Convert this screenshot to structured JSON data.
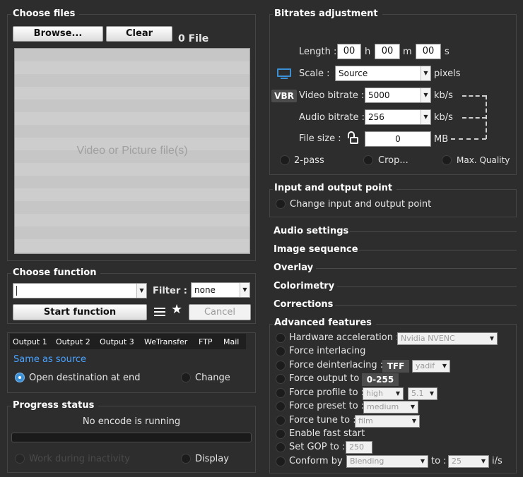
{
  "choose_files": {
    "title": "Choose files",
    "browse": "Browse...",
    "clear": "Clear",
    "file_count": "0 File",
    "drop_hint": "Video or Picture file(s)"
  },
  "choose_function": {
    "title": "Choose function",
    "function_value": "",
    "filter_label": "Filter :",
    "filter_value": "none",
    "start": "Start function",
    "cancel": "Cancel"
  },
  "output": {
    "tabs": [
      "Output 1",
      "Output 2",
      "Output 3",
      "WeTransfer",
      "FTP",
      "Mail"
    ],
    "destination": "Same as source",
    "open_dest": "Open destination at end",
    "change": "Change"
  },
  "progress": {
    "title": "Progress status",
    "status": "No encode is running",
    "progress_fraction": 0,
    "work_inactivity": "Work during inactivity",
    "display": "Display"
  },
  "bitrates": {
    "title": "Bitrates adjustment",
    "length_label": "Length :",
    "h_value": "00",
    "h_unit": "h",
    "m_value": "00",
    "m_unit": "m",
    "s_value": "00",
    "s_unit": "s",
    "scale_label": "Scale :",
    "scale_value": "Source",
    "scale_unit": "pixels",
    "vbr_badge": "VBR",
    "video_label": "Video bitrate :",
    "video_value": "5000",
    "video_unit": "kb/s",
    "audio_label": "Audio bitrate :",
    "audio_value": "256",
    "audio_unit": "kb/s",
    "filesize_label": "File size :",
    "filesize_value": "0",
    "filesize_unit": "MB",
    "two_pass": "2-pass",
    "crop": "Crop...",
    "max_quality": "Max. Quality"
  },
  "io_point": {
    "title": "Input and output point",
    "change": "Change input and output point"
  },
  "sections": {
    "audio": "Audio settings",
    "image_seq": "Image sequence",
    "overlay": "Overlay",
    "colorimetry": "Colorimetry",
    "corrections": "Corrections"
  },
  "advanced": {
    "title": "Advanced features",
    "hw_label": "Hardware acceleration :",
    "hw_value": "Nvidia NVENC",
    "interlacing": "Force interlacing",
    "deinterlacing": "Force deinterlacing :",
    "tff": "TFF",
    "deint_value": "yadif",
    "output_to": "Force output to :",
    "output_range": "0-255",
    "profile_to": "Force profile to :",
    "profile_value": "high",
    "level_value": "5.1",
    "preset_to": "Force preset to :",
    "preset_value": "medium",
    "tune_to": "Force tune to :",
    "tune_value": "film",
    "fast_start": "Enable fast start",
    "gop_label": "Set GOP to :",
    "gop_value": "250",
    "conform_label": "Conform by :",
    "conform_value": "Blending",
    "conform_to": "to :",
    "fps_value": "25",
    "fps_unit": "i/s"
  },
  "colors": {
    "background": "#2d2d2d",
    "accent_blue": "#3d8fd4",
    "link_blue": "#4aa3ff"
  }
}
